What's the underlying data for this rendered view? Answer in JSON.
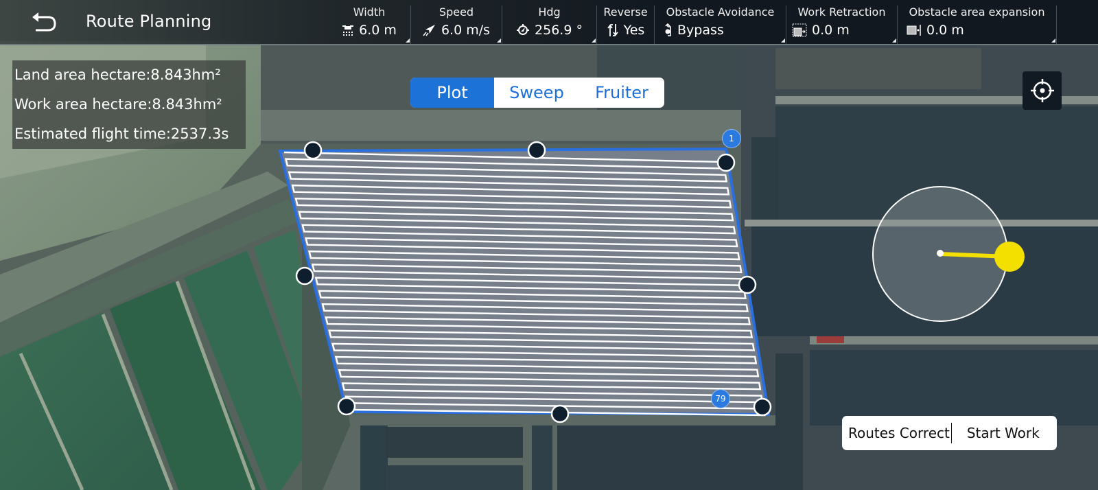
{
  "header": {
    "title": "Route Planning",
    "back_icon": "back-arrow-icon"
  },
  "params": [
    {
      "id": "width",
      "label": "Width",
      "value": "6.0 m",
      "icon": "drone-spray-icon"
    },
    {
      "id": "speed",
      "label": "Speed",
      "value": "6.0 m/s",
      "icon": "speed-plane-icon"
    },
    {
      "id": "heading",
      "label": "Hdg",
      "value": "256.9 °",
      "icon": "heading-compass-icon"
    },
    {
      "id": "reverse",
      "label": "Reverse",
      "value": "Yes",
      "icon": "reverse-arrows-icon"
    },
    {
      "id": "obstacle-avoidance",
      "label": "Obstacle Avoidance",
      "value": "Bypass",
      "icon": "bypass-icon"
    },
    {
      "id": "work-retraction",
      "label": "Work Retraction",
      "value": "0.0 m",
      "icon": "retraction-icon"
    },
    {
      "id": "obstacle-expansion",
      "label": "Obstacle area expansion",
      "value": "0.0 m",
      "icon": "expansion-icon"
    }
  ],
  "stats": {
    "land_area": "Land area hectare:8.843hm²",
    "work_area": "Work area hectare:8.843hm²",
    "flight_time": "Estimated flight time:2537.3s"
  },
  "modes": {
    "active": "Plot",
    "tabs": [
      "Plot",
      "Sweep",
      "Fruiter"
    ]
  },
  "route": {
    "start_waypoint": "1",
    "end_waypoint": "79",
    "heading_deg": 256.9
  },
  "actions": {
    "routes_correct": "Routes Correct",
    "start_work": "Start Work"
  },
  "colors": {
    "accent": "#1d72d8",
    "boundary": "#2a6fe0",
    "vertex": "#0f1e2c",
    "heading_handle": "#f3df00"
  }
}
